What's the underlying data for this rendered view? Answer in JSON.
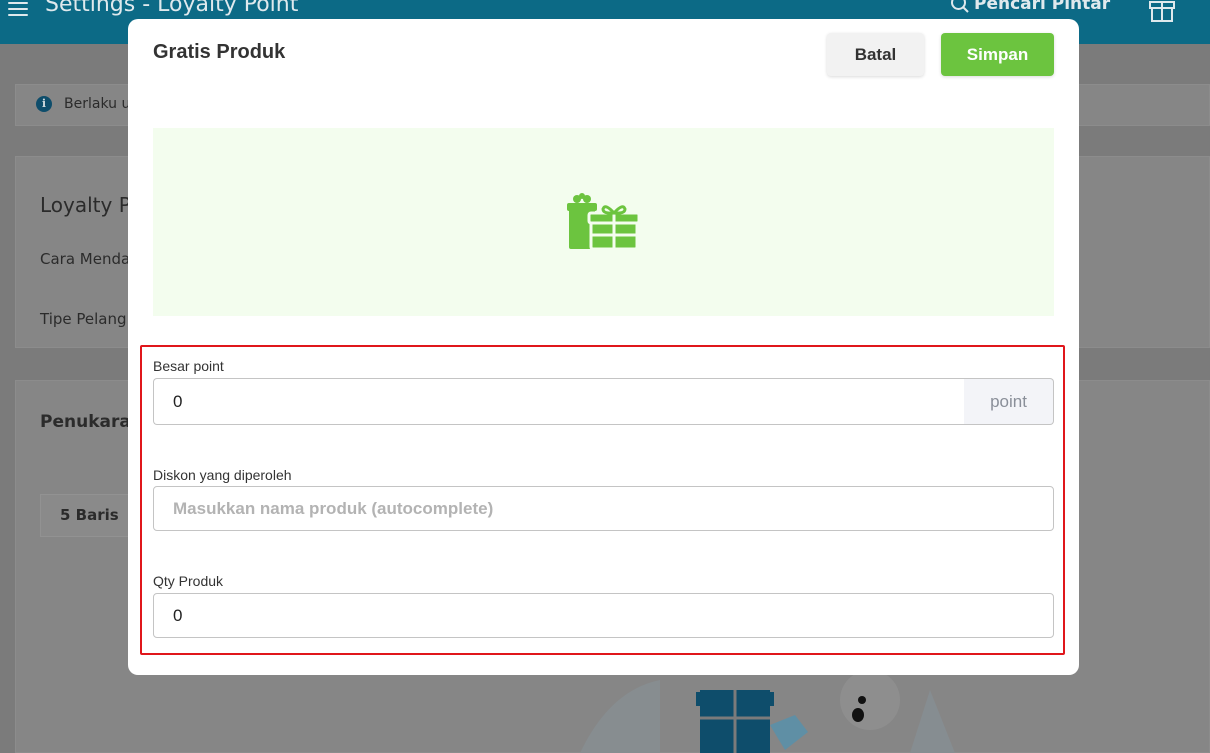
{
  "background": {
    "page_title": "Settings - Loyalty Point",
    "smart_search": "Pencari Pintar",
    "info_text": "Berlaku u",
    "section_title": "Loyalty P",
    "row1_label": "Cara Menda",
    "row2_label": "Tipe Pelang",
    "section2_title": "Penukara",
    "rows_button": "5 Baris"
  },
  "modal": {
    "title": "Gratis Produk",
    "cancel_label": "Batal",
    "save_label": "Simpan",
    "fields": {
      "points": {
        "label": "Besar point",
        "value": "0",
        "suffix": "point"
      },
      "discount": {
        "label": "Diskon yang diperoleh",
        "value": "",
        "placeholder": "Masukkan nama produk (autocomplete)"
      },
      "qty": {
        "label": "Qty Produk",
        "value": "0"
      }
    }
  },
  "colors": {
    "brand_green": "#6cc43f",
    "banner_bg": "#f3fdee",
    "highlight_red": "#e0161b",
    "topbar": "#0c6a86"
  },
  "icons": {
    "banner": "gift-icon",
    "topbar": "gift-box-icon",
    "search": "search-icon",
    "menu": "hamburger-menu-icon",
    "info": "info-icon"
  }
}
